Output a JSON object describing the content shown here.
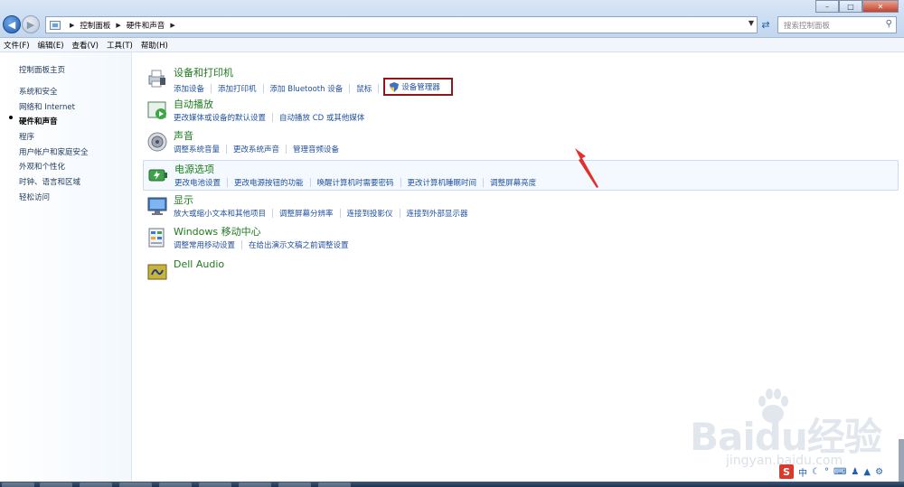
{
  "address_bar": {
    "crumbs": [
      "控制面板",
      "硬件和声音"
    ],
    "search_placeholder": "搜索控制面板"
  },
  "menu": [
    "文件(F)",
    "编辑(E)",
    "查看(V)",
    "工具(T)",
    "帮助(H)"
  ],
  "sidebar": {
    "home": "控制面板主页",
    "items": [
      {
        "label": "系统和安全"
      },
      {
        "label": "网络和 Internet"
      },
      {
        "label": "硬件和声音",
        "current": true
      },
      {
        "label": "程序"
      },
      {
        "label": "用户帐户和家庭安全"
      },
      {
        "label": "外观和个性化"
      },
      {
        "label": "时钟、语言和区域"
      },
      {
        "label": "轻松访问"
      }
    ]
  },
  "categories": [
    {
      "title": "设备和打印机",
      "icon": "printer-icon",
      "links": [
        "添加设备",
        "添加打印机",
        "添加 Bluetooth 设备",
        "鼠标",
        "设备管理器"
      ]
    },
    {
      "title": "自动播放",
      "icon": "autoplay-icon",
      "links": [
        "更改媒体或设备的默认设置",
        "自动播放 CD 或其他媒体"
      ]
    },
    {
      "title": "声音",
      "icon": "speaker-icon",
      "links": [
        "调整系统音量",
        "更改系统声音",
        "管理音频设备"
      ]
    },
    {
      "title": "电源选项",
      "icon": "battery-icon",
      "links": [
        "更改电池设置",
        "更改电源按钮的功能",
        "唤醒计算机时需要密码",
        "更改计算机睡眠时间",
        "调整屏幕亮度"
      ]
    },
    {
      "title": "显示",
      "icon": "display-icon",
      "links": [
        "放大或缩小文本和其他项目",
        "调整屏幕分辨率",
        "连接到投影仪",
        "连接到外部显示器"
      ]
    },
    {
      "title": "Windows 移动中心",
      "icon": "mobility-center-icon",
      "links": [
        "调整常用移动设置",
        "在给出演示文稿之前调整设置"
      ]
    },
    {
      "title": "Dell Audio",
      "icon": "dell-audio-icon",
      "links": []
    }
  ],
  "watermark": {
    "brand": "Baidu经验",
    "url": "jingyan.baidu.com"
  },
  "ime": {
    "lang": "中"
  },
  "colors": {
    "category_title": "#1e7b1e",
    "link": "#1f4e9c",
    "highlight_box": "#8b1a1a",
    "arrow": "#e0322b"
  }
}
